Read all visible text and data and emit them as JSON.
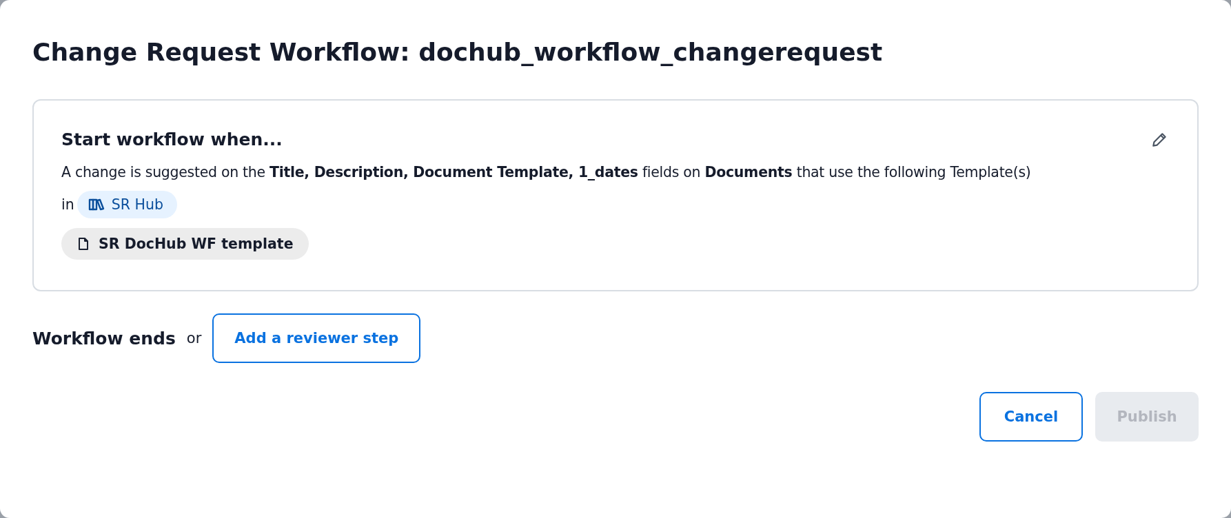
{
  "dialog": {
    "title": "Change Request Workflow: dochub_workflow_changerequest"
  },
  "trigger": {
    "heading": "Start workflow when...",
    "sentence": "A change is suggested on the **Title, Description, Document Template, 1_dates** fields on **Documents** that use the following Template(s)",
    "location_prefix": "in",
    "hub": "SR Hub",
    "templates": [
      "SR DocHub WF template"
    ]
  },
  "end_step": {
    "label": "Workflow ends",
    "connector": "or",
    "add_button": "Add a reviewer step"
  },
  "buttons": [
    {
      "label": "Cancel",
      "kind": "secondary",
      "disabled": false
    },
    {
      "label": "Publish",
      "kind": "primary",
      "disabled": true
    }
  ]
}
